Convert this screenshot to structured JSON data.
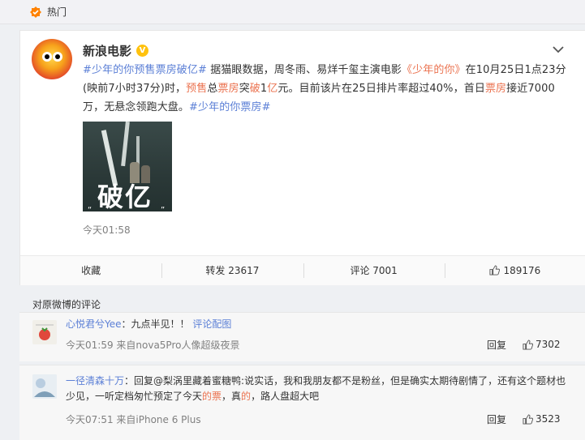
{
  "topbar": {
    "label": "热门"
  },
  "post": {
    "author": "新浪电影",
    "verified_mark": "V",
    "content": {
      "topic1": "#少年的你预售票房破亿#",
      "t1": " 据猫眼数据，周冬雨、易烊千玺主演电影",
      "film": "《少年的你》",
      "t2": "在10月25日1点23分(映前7小时37分)时，",
      "presale": "预售",
      "t3": "总",
      "boxoffice1": "票房",
      "t4": "突",
      "break": "破",
      "t5": "1",
      "yi": "亿",
      "t6": "元。目前该片在25日排片率超过40%，首日",
      "boxoffice2": "票房",
      "t7": "接近7000万，无悬念领跑大盘。",
      "topic2": "#少年的你票房#"
    },
    "image_text": "破亿",
    "image_quote_l": "“",
    "image_quote_r": "”",
    "timestamp": "今天01:58",
    "actions": {
      "collect": "收藏",
      "repost": "转发 23617",
      "comment": "评论 7001",
      "like": "189176"
    }
  },
  "comments_title": "对原微博的评论",
  "comments": [
    {
      "name": "心悦君兮Yee",
      "colon": "：",
      "text": "九点半见！！",
      "link": "评论配图",
      "meta": "今天01:59 来自nova5Pro人像超级夜景",
      "reply": "回复",
      "likes": "7302"
    },
    {
      "name": "一径清森十万",
      "colon": "：",
      "text_a": "回复@梨涡里藏着蜜糖鸭:说实话，我和我朋友都不是粉丝，但是确实太期待剧情了，还有这个题材也少见，一听定档匆忙预定了今天",
      "hl1": "的票",
      "text_b": "，真",
      "hl2": "的",
      "text_c": "，路人盘超大吧",
      "meta": "今天07:51 来自iPhone 6 Plus",
      "reply": "回复",
      "likes": "3523"
    }
  ],
  "colors": {
    "link": "#5b7fd6",
    "highlight": "#eb7350"
  }
}
